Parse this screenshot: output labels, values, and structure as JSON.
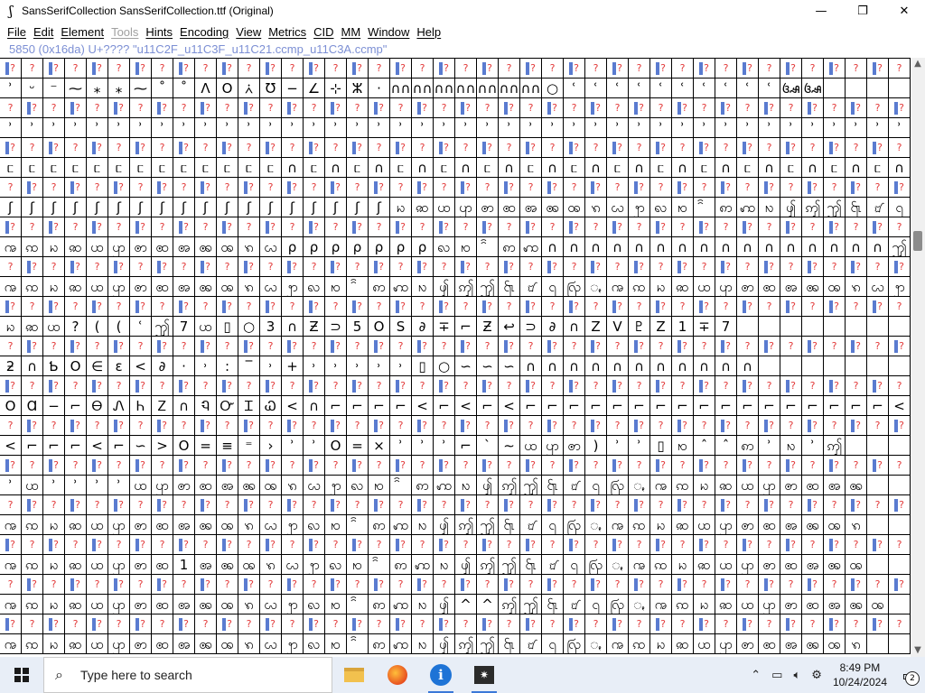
{
  "window": {
    "title": "SansSerifCollection  SansSerifCollection.ttf (Original)",
    "app_icon_glyph": "ʃ",
    "minimize": "—",
    "maximize": "❐",
    "close": "✕"
  },
  "menu": {
    "items": [
      {
        "label": "File",
        "enabled": true
      },
      {
        "label": "Edit",
        "enabled": true
      },
      {
        "label": "Element",
        "enabled": true
      },
      {
        "label": "Tools",
        "enabled": false
      },
      {
        "label": "Hints",
        "enabled": true
      },
      {
        "label": "Encoding",
        "enabled": true
      },
      {
        "label": "View",
        "enabled": true
      },
      {
        "label": "Metrics",
        "enabled": true
      },
      {
        "label": "CID",
        "enabled": true
      },
      {
        "label": "MM",
        "enabled": true
      },
      {
        "label": "Window",
        "enabled": true
      },
      {
        "label": "Help",
        "enabled": true
      }
    ]
  },
  "info_line": "5850 (0x16da) U+???? \"u11C2F_u11C3F_u11C21.ccmp_u11C3A.ccmp\"",
  "grid": {
    "label_pattern": [
      "?",
      "?",
      "?",
      "?",
      "?",
      "?",
      "?",
      "?",
      "?",
      "?",
      "?",
      "?",
      "?",
      "?",
      "?",
      "?",
      "?",
      "?",
      "?",
      "?",
      "?",
      "?",
      "?",
      "?",
      "?",
      "?",
      "?",
      "?",
      "?",
      "?",
      "?",
      "?",
      "?",
      "?",
      "?",
      "?",
      "?",
      "?",
      "?",
      "?",
      "?",
      "?"
    ],
    "rows": [
      "ʾ ᵕ ⁻ ⁓ ⁎ ⁎ ⁓ ˚ ˚ Λ O ⩑ Ʊ − ∠ ⊹ ⵣ · ∩∩ ∩∩ ∩∩ ∩∩ ∩∩ ∩∩ ∩∩ ○ ʿ ʿ ʿ ʿ ʿ ʿ ʿ ʿ ʿ ʿ ꦄ ꦄ",
      "ʾ ʾ ʾ ʾ ʾ ʾ ʾ ʾ ʾ ʾ ʾ ʾ ʾ ʾ ʾ ʾ ʾ ʾ ʾ ʾ ʾ ʾ ʾ ʾ ʾ ʾ ʾ ʾ ʾ ʾ ʾ ʾ ʾ ʾ ʾ ʾ ʾ ʾ ʾ ʾ ʾ ʾ",
      "ᥴ ᥴ ᥴ ᥴ ᥴ ᥴ ᥴ ᥴ ᥴ ᥴ ᥴ ᥴ ᥴ ∩ ᥴ ∩ ᥴ ∩ ᥴ ∩ ᥴ ∩ ᥴ ∩ ᥴ ∩ ᥴ ∩ ᥴ ∩ ᥴ ∩ ᥴ ∩ ᥴ ∩ ᥴ ∩ ᥴ ∩ ᥴ ∩",
      "ʃ ʃ ʃ ʃ ʃ ʃ ʃ ʃ ʃ ʃ ʃ ʃ ʃ ʃ ʃ ʃ ʃ ʃ ꩢ ꩣ ꩤ ꩥ ꩦ ꩧ ꩨ ꩩ ꩪ ꩫ ꩬ ꩭ ꩮ ꩯ ꩰ ꩱ ꩲ ꩳ ꩴ ꩵ ꩶ ꩷ ꩸ ꩹",
      "ꩠ ꩡ ꩢ ꩣ ꩤ ꩥ ꩦ ꩧ ꩨ ꩩ ꩪ ꩫ ꩬ ρ ρ ρ ρ ρ ρ ρ ꩮ ꩯ ꩰ ꩱ ꩲ ∩ ∩ ∩ ∩ ∩ ∩ ∩ ∩ ∩ ∩ ∩ ∩ ∩ ∩ ∩ ∩ ꩶ",
      "ꩠ ꩡ ꩢ ꩣ ꩤ ꩥ ꩦ ꩧ ꩨ ꩩ ꩪ ꩫ ꩬ ꩭ ꩮ ꩯ ꩰ ꩱ ꩲ ꩳ ꩴ ꩵ ꩶ ꩷ ꩸ ꩹ ꩺ ꩻ ꩠ ꩡ ꩢ ꩣ ꩤ ꩥ ꩦ ꩧ ꩨ ꩩ ꩪ ꩫ ꩬ ꩭ",
      "ꩢ ꩣ ꩤ ? ( ( ʿ ꩶ     7 ꩤ ▯   ○ 3 ∩ Ƶ ⊃ 5 O S ∂ ∓ ⌐ Ƶ ↩ ⊃ ∂ ∩ Z V ♇ Z 1 ∓ 7",
      "ƻ ∩ Ƅ O ∈ ɛ < ∂ · ˒ : ‾ ˒ + ˒ ˒ ˒ ˒ ˒ ▯   ○ ∽ ∽ ∽ ∩ ∩ ∩ ∩ ∩ ∩ ∩ ∩ ∩ ∩ ∩",
      "O Ɑ − ⌐ Ꮎ Ꮑ Ꮒ Ꮓ ∩ Ꮔ Ꮕ Ꮖ Ꮗ < ∩ ⌐ ⌐ ⌐ ⌐ < ⌐ < ⌐ < ⌐ ⌐ ⌐ ⌐ ⌐ ⌐ ⌐ ⌐ ⌐ ⌐ ⌐ ⌐ ⌐ ⌐ ⌐ ⌐ ⌐ <",
      "< ⌐ ⌐ ⌐ < ⌐ ∽ > O = ≡ ⁼ › ʾ ʾ O = × ʾ ʾ ʾ ⌐ ˋ ∼ ꩤ ꩥ ꩦ ) ʾ ʾ ▯ ꩯ ˆ ˆ ꩱ ʾ ꩳ ʾ ꩵ",
      "ʾ ꩤ ʾ ʾ ʾ ʾ ꩤ ꩥ ꩦ ꩧ ꩨ ꩩ ꩪ ꩫ ꩬ ꩭ ꩮ ꩯ ꩰ ꩱ ꩲ ꩳ ꩴ ꩵ ꩶ ꩷ ꩸ ꩹ ꩺ ꩻ ꩠ ꩡ ꩢ ꩣ ꩤ ꩥ ꩦ ꩧ ꩨ ꩩ",
      "ꩠ ꩡ ꩢ ꩣ ꩤ ꩥ ꩦ ꩧ ꩨ ꩩ ꩪ ꩫ ꩬ ꩭ ꩮ ꩯ ꩰ ꩱ ꩲ ꩳ ꩴ ꩵ ꩶ ꩷ ꩸ ꩹ ꩺ ꩻ ꩠ ꩡ ꩢ ꩣ ꩤ ꩥ ꩦ ꩧ ꩨ ꩩ ꩪ ꩫ",
      "ꩠ ꩡ ꩢ ꩣ ꩤ ꩥ ꩦ ꩧ 1 ꩨ ꩩ ꩪ ꩫ ꩬ ꩭ ꩮ ꩯ ꩰ ꩱ ꩲ ꩳ ꩴ ꩵ ꩶ ꩷ ꩸ ꩹ ꩺ ꩻ ꩠ ꩡ ꩢ ꩣ ꩤ ꩥ ꩦ ꩧ ꩨ ꩩ ꩪ",
      "ꩠ ꩡ ꩢ ꩣ ꩤ ꩥ ꩦ ꩧ ꩨ ꩩ ꩪ ꩫ ꩬ ꩭ ꩮ ꩯ ꩰ ꩱ ꩲ ꩳ ꩴ ^ ^ ꩵ ꩶ ꩷ ꩸ ꩹ ꩺ ꩻ ꩠ ꩡ ꩢ ꩣ ꩤ ꩥ ꩦ ꩧ ꩨ ꩩ ꩪ",
      "ꩠ ꩡ ꩢ ꩣ ꩤ ꩥ ꩦ ꩧ ꩨ ꩩ ꩪ ꩫ ꩬ ꩭ ꩮ ꩯ ꩰ ꩱ ꩲ ꩳ ꩴ ꩵ ꩶ ꩷ ꩸ ꩹ ꩺ ꩻ ꩠ ꩡ ꩢ ꩣ ꩤ ꩥ ꩦ ꩧ ꩨ ꩩ ꩪ ꩫ"
    ]
  },
  "taskbar": {
    "search_placeholder": "Type here to search",
    "time": "8:49 PM",
    "date": "10/24/2024",
    "notification_count": "2",
    "colors": {
      "accent": "#3b78d8",
      "taskbar_bg": "#e8eef7"
    }
  }
}
